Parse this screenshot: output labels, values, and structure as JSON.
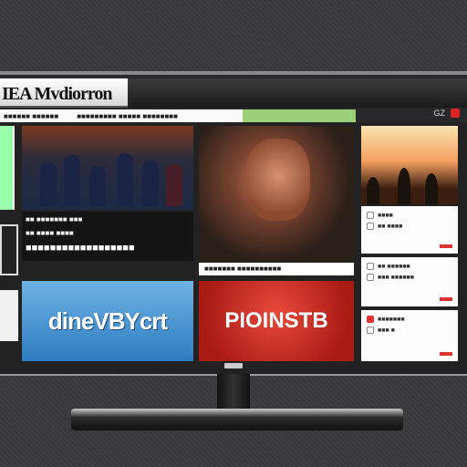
{
  "window": {
    "title": "IEA Mvdiorron",
    "tools": [
      "GZ",
      "▲"
    ]
  },
  "nav": {
    "items": [
      "■■■■■■ ■■■■■■",
      "■■■■■■■■■ ■■■■■ ■■■■■■■■"
    ]
  },
  "tiles": {
    "feature_a": {
      "line1": "■■ ■■■■■■■ ■■■",
      "line2": "■■ ■■■■ ■■■■",
      "headline": "■■■■■■■■■■■■■■■■■■"
    },
    "feature_b": {
      "caption": "■■■■■■■ ■■■■■■■■■■"
    },
    "side_cards": [
      {
        "line1": "■■■■",
        "line2": "■■ ■■■■"
      },
      {
        "line1": "■■ ■■■■■■",
        "line2": "■■■ ■■■■■■"
      },
      {
        "line1": "■■■■■■■",
        "line2": "■■■ ■"
      }
    ],
    "promo_blue": {
      "logo": "dineVBYcrt"
    },
    "promo_red": {
      "logo": "PIOINSTB"
    }
  },
  "colors": {
    "accent_red": "#d22222",
    "nav_green": "#9bcf7a",
    "promo_blue": "#2d7bc0",
    "promo_red": "#e84a3a"
  }
}
